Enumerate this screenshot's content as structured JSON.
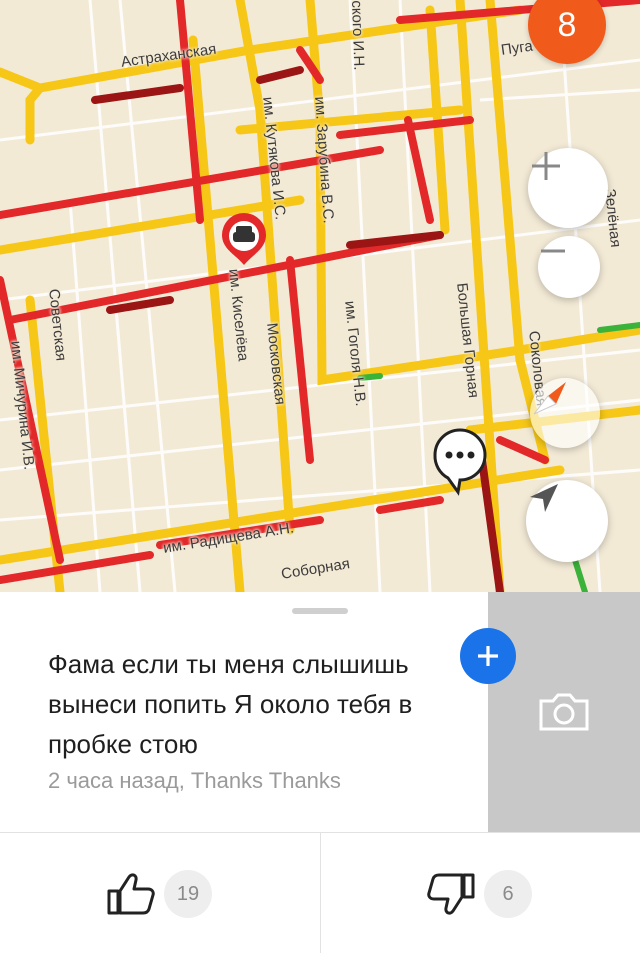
{
  "map": {
    "streets": {
      "astrakhanskaya": "Астраханская",
      "pugacheva": "Пуга",
      "skogo": "ского И.Н.",
      "zarubina": "им. Зарубина В.С.",
      "kutyakova": "им. Кутякова И.С.",
      "zelenaya": "Зелёная",
      "sovetskaya": "Советская",
      "kiseleva": "им. Киселёва",
      "moskovskaya": "Московская",
      "gogolya": "им. Гоголя Н.В.",
      "bolshaya_gornaya": "Большая Горная",
      "sokolovaya": "Соколовая",
      "michurina": "им. Мичурина И.В.",
      "radishcheva": "им. Радищева А.Н.",
      "sobornaya": "Соборная"
    },
    "event_badge": "8",
    "colors": {
      "jam_red": "#e3282a",
      "slow_yellow": "#f6c716",
      "heavy_darkred": "#9b1515",
      "free_green": "#3bb33b",
      "badge_orange": "#f05a1a"
    }
  },
  "controls": {
    "zoom_in_icon": "plus-icon",
    "zoom_out_icon": "minus-icon",
    "compass_icon": "compass-icon",
    "locate_icon": "navigation-arrow-icon"
  },
  "card": {
    "message": "Фама если ты меня слышишь вынеси попить Я около тебя в пробке стою",
    "meta": "2 часа назад, Thanks Thanks",
    "photo_icon": "camera-icon",
    "add_icon": "plus-icon",
    "likes": "19",
    "dislikes": "6",
    "accent": "#1a73e8"
  }
}
